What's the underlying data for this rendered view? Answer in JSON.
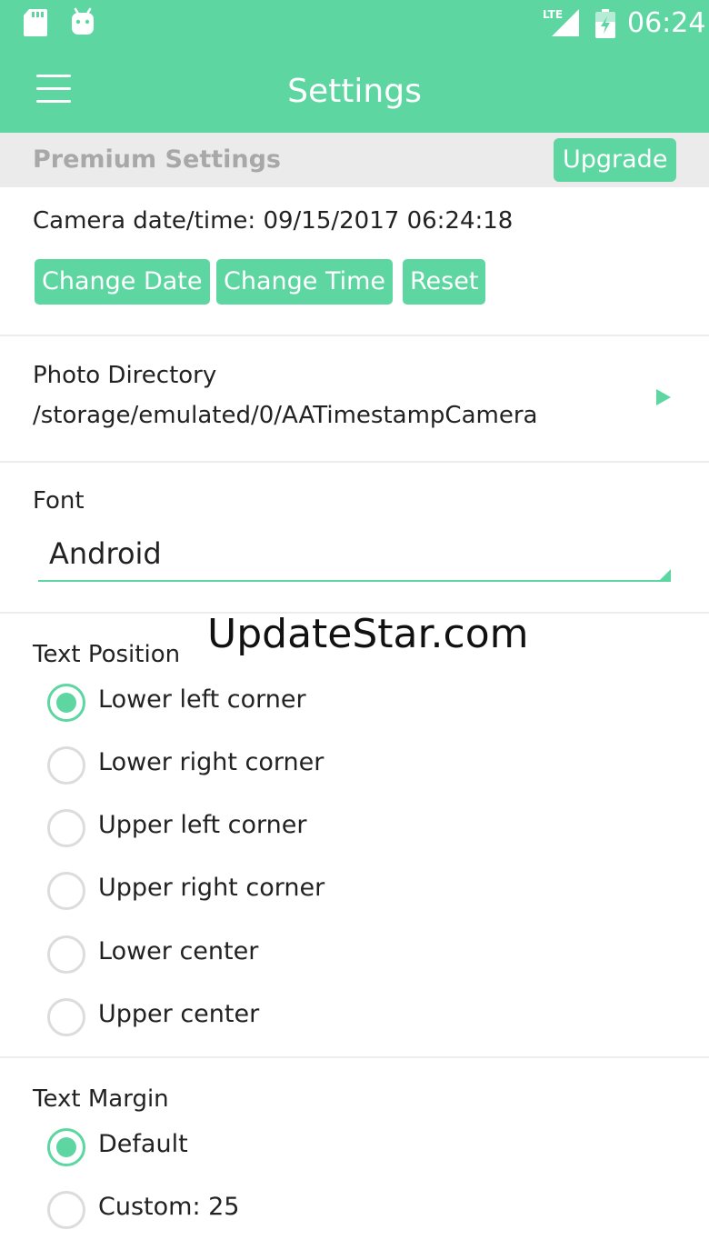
{
  "status_bar": {
    "time": "06:24",
    "network": "LTE",
    "icons": [
      "sd-card-icon",
      "android-icon",
      "lte-signal-icon",
      "battery-icon"
    ]
  },
  "app_bar": {
    "title": "Settings",
    "menu_icon": "hamburger-menu-icon"
  },
  "premium": {
    "header": "Premium Settings",
    "upgrade_label": "Upgrade"
  },
  "camera_datetime": {
    "label": "Camera date/time: 09/15/2017 06:24:18",
    "buttons": {
      "change_date": "Change Date",
      "change_time": "Change Time",
      "reset": "Reset"
    }
  },
  "photo_directory": {
    "title": "Photo Directory",
    "path": "/storage/emulated/0/AATimestampCamera"
  },
  "font": {
    "label": "Font",
    "selected": "Android"
  },
  "watermark": "UpdateStar.com",
  "text_position": {
    "label": "Text Position",
    "options": [
      {
        "label": "Lower left corner",
        "checked": true
      },
      {
        "label": "Lower right corner",
        "checked": false
      },
      {
        "label": "Upper left corner",
        "checked": false
      },
      {
        "label": "Upper right corner",
        "checked": false
      },
      {
        "label": "Lower center",
        "checked": false
      },
      {
        "label": "Upper center",
        "checked": false
      }
    ]
  },
  "text_margin": {
    "label": "Text Margin",
    "options": [
      {
        "label": "Default",
        "checked": true
      },
      {
        "label": "Custom: 25",
        "checked": false
      }
    ]
  },
  "colors": {
    "accent": "#5dd6a2",
    "premium_header_bg": "#ebebeb",
    "premium_header_text": "#a8a8a8"
  }
}
